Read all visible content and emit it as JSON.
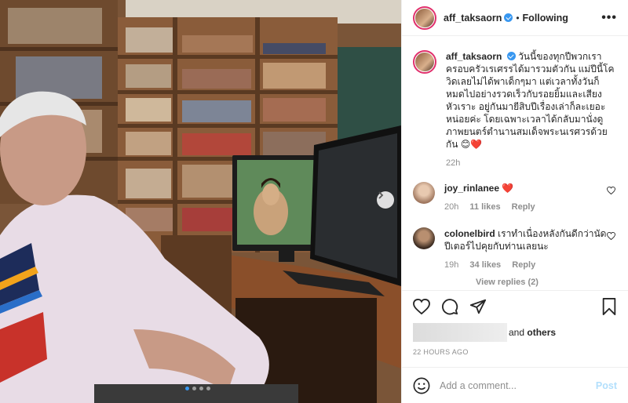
{
  "post": {
    "username": "aff_taksaorn",
    "separator": "•",
    "follow_status": "Following",
    "more_label": "•••",
    "caption": "วันนี้ของทุกปีพวกเราครอบครัวเรเศรรได้มารวมตัวกัน แม่ปีนี้โควิดเลยไม่ได้พาเด็กๆมา แต่เวลาทั้งวันก็หมดไปอย่างรวดเร็วกับรอยยิ้มและเสียงหัวเราะ อยู่กันมายีสิบปีเรื่องเล่าก็ละเยอะหน่อยค่ะ โดยเฉพาะเวลาได้กลับมานั่งดูภาพยนตร์ตำนานสมเด็จพระนเรศวรด้วยกัน 😊❤️",
    "caption_time": "22h",
    "posted_ago": "22 HOURS AGO"
  },
  "comments": [
    {
      "username": "joy_rinlanee",
      "text": "❤️",
      "time": "20h",
      "likes": "11 likes",
      "reply": "Reply"
    },
    {
      "username": "colonelbird",
      "text": "เราทำเนื่องหลังกันดีกว่านัดปีเตอร์ไปคุยกับท่านเลยนะ",
      "time": "19h",
      "likes": "34 likes",
      "reply": "Reply"
    }
  ],
  "view_replies": "View replies (2)",
  "likes_text": {
    "and": "and",
    "others": "others"
  },
  "add_comment": {
    "placeholder": "Add a comment...",
    "post_label": "Post"
  },
  "carousel": {
    "total_slides": 4,
    "active_slide": 1
  },
  "colors": {
    "accent": "#3897f0",
    "post_disabled": "#b2dffc",
    "muted": "#8e8e8e",
    "heart": "#ed4956"
  },
  "icons": [
    "more-icon",
    "verified-icon",
    "heart-icon",
    "comment-icon",
    "share-icon",
    "save-icon",
    "emoji-icon",
    "next-arrow-icon"
  ]
}
